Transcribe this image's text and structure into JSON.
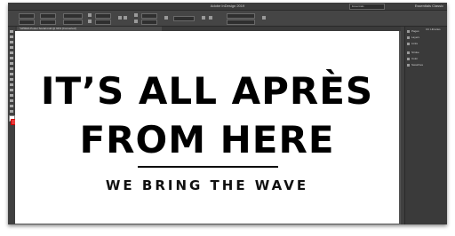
{
  "window": {
    "app_title": "Adobe InDesign 2019",
    "user_label": "Essentials Classic",
    "workspace": "Essentials"
  },
  "document": {
    "tab_label": "*APRES Poster Social.indd @ 94% [Converted]",
    "headline_line1": "IT’S ALL APRÈS",
    "headline_line2": "FROM HERE",
    "tagline": "WE BRING THE WAVE"
  },
  "panels": {
    "items": [
      "Pages",
      "Layers",
      "Links",
      "Stroke",
      "Color",
      "Swatches"
    ],
    "secondary": "CC Libraries"
  },
  "colors": {
    "ui_dark": "#3a3a3a",
    "pasteboard": "#535353",
    "page": "#ffffff",
    "text": "#000000"
  }
}
